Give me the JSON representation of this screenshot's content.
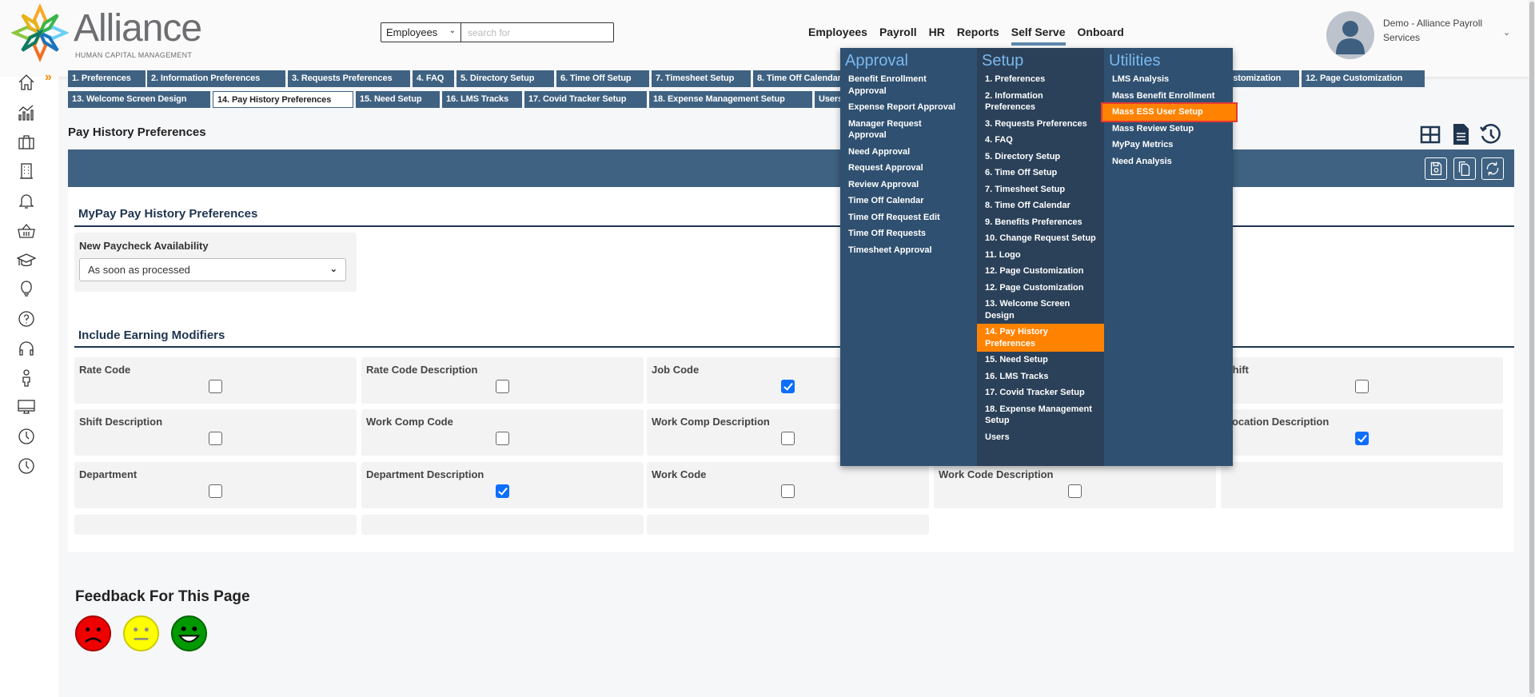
{
  "header": {
    "logo_text": "Alliance",
    "logo_sub": "HUMAN CAPITAL MANAGEMENT",
    "search_scope": "Employees",
    "search_placeholder": "search for",
    "nav": [
      "Employees",
      "Payroll",
      "HR",
      "Reports",
      "Self Serve",
      "Onboard"
    ],
    "active_nav": "Self Serve",
    "user_name": "Demo - Alliance Payroll Services"
  },
  "sidebar": {
    "icons": [
      "home-icon",
      "analytics-icon",
      "briefcase-icon",
      "building-icon",
      "bell-icon",
      "basket-icon",
      "graduation-cap-icon",
      "lightbulb-icon",
      "help-icon",
      "headphones-icon",
      "person-icon",
      "monitor-icon",
      "clock-icon",
      "clock-icon"
    ]
  },
  "tabs": {
    "row1": [
      "1. Preferences",
      "2. Information Preferences",
      "3. Requests Preferences",
      "4. FAQ",
      "5. Directory Setup",
      "6. Time Off Setup",
      "7. Timesheet Setup",
      "8. Time Off Calendar",
      "12. Page Customization",
      "12. Page Customization"
    ],
    "row2": [
      "13. Welcome Screen Design",
      "14. Pay History Preferences",
      "15. Need Setup",
      "16. LMS Tracks",
      "17. Covid Tracker Setup",
      "18. Expense Management Setup",
      "Users"
    ],
    "active": "14. Pay History Preferences"
  },
  "page": {
    "title": "Pay History Preferences",
    "section1_title": "MyPay Pay History Preferences",
    "paycheck_label": "New Paycheck Availability",
    "paycheck_value": "As soon as processed",
    "section2_title": "Include Earning Modifiers",
    "modifiers": [
      {
        "label": "Rate Code",
        "checked": false
      },
      {
        "label": "Rate Code Description",
        "checked": false
      },
      {
        "label": "Job Code",
        "checked": true
      },
      {
        "label": "",
        "checked": false
      },
      {
        "label": "Shift",
        "checked": false
      },
      {
        "label": "Shift Description",
        "checked": false
      },
      {
        "label": "Work Comp Code",
        "checked": false
      },
      {
        "label": "Work Comp Description",
        "checked": false
      },
      {
        "label": "",
        "checked": false
      },
      {
        "label": "Location Description",
        "checked": true
      },
      {
        "label": "Department",
        "checked": false
      },
      {
        "label": "Department Description",
        "checked": true
      },
      {
        "label": "Work Code",
        "checked": false
      },
      {
        "label": "Work Code Description",
        "checked": false
      }
    ],
    "feedback_title": "Feedback For This Page"
  },
  "mega_menu": {
    "approval": {
      "title": "Approval",
      "items": [
        "Benefit Enrollment\nApproval",
        "Expense Report Approval",
        "Manager Request\nApproval",
        "Need Approval",
        "Request Approval",
        "Review Approval",
        "Time Off Calendar",
        "Time Off Request Edit",
        "Time Off Requests",
        "Timesheet Approval"
      ]
    },
    "setup": {
      "title": "Setup",
      "items": [
        "1. Preferences",
        "2. Information\nPreferences",
        "3. Requests Preferences",
        "4. FAQ",
        "5. Directory Setup",
        "6. Time Off Setup",
        "7. Timesheet Setup",
        "8. Time Off Calendar",
        "9. Benefits Preferences",
        "10. Change Request Setup",
        "11. Logo",
        "12. Page Customization",
        "12. Page Customization",
        "13. Welcome Screen\nDesign",
        "14. Pay History\nPreferences",
        "15. Need Setup",
        "16. LMS Tracks",
        "17. Covid Tracker Setup",
        "18. Expense Management\nSetup",
        "Users"
      ],
      "selected": 14
    },
    "utilities": {
      "title": "Utilities",
      "items": [
        "LMS Analysis",
        "Mass Benefit Enrollment",
        "Mass ESS User Setup",
        "Mass Review Setup",
        "MyPay Metrics",
        "Need Analysis"
      ],
      "highlighted": 2
    }
  },
  "colors": {
    "brand_blue": "#3f6282",
    "menu_highlight": "#ff8200",
    "heading_blue": "#7ab8ef",
    "checkbox_checked": "#0d6efd"
  }
}
